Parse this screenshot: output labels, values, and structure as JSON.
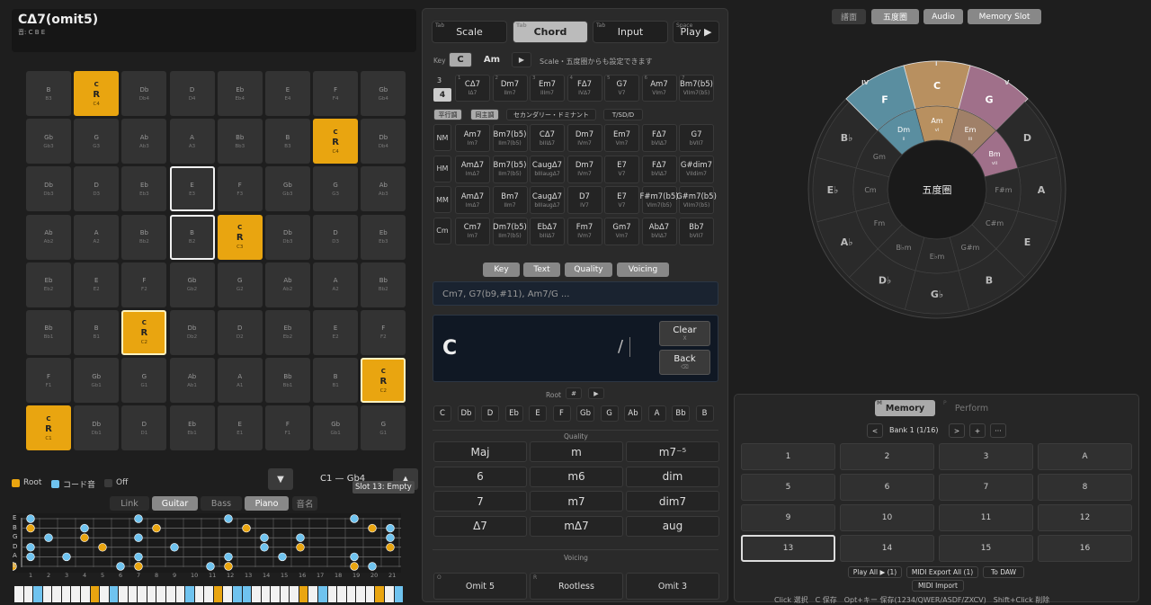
{
  "chord": {
    "name": "CΔ7(omit5)",
    "tones": "音: C B E"
  },
  "pads": [
    [
      [
        "B",
        "",
        "B3",
        ""
      ],
      [
        "C",
        "R",
        "C4",
        "root"
      ],
      [
        "Db",
        "",
        "Db4",
        ""
      ],
      [
        "D",
        "",
        "D4",
        ""
      ],
      [
        "Eb",
        "",
        "Eb4",
        ""
      ],
      [
        "E",
        "",
        "E4",
        ""
      ],
      [
        "F",
        "",
        "F4",
        ""
      ],
      [
        "Gb",
        "",
        "Gb4",
        ""
      ]
    ],
    [
      [
        "Gb",
        "",
        "Gb3",
        ""
      ],
      [
        "G",
        "",
        "G3",
        ""
      ],
      [
        "Ab",
        "",
        "Ab3",
        ""
      ],
      [
        "A",
        "",
        "A3",
        ""
      ],
      [
        "Bb",
        "",
        "Bb3",
        ""
      ],
      [
        "B",
        "",
        "B3",
        ""
      ],
      [
        "C",
        "R",
        "C4",
        "root"
      ],
      [
        "Db",
        "",
        "Db4",
        ""
      ]
    ],
    [
      [
        "Db",
        "",
        "Db3",
        ""
      ],
      [
        "D",
        "",
        "D3",
        ""
      ],
      [
        "Eb",
        "",
        "Eb3",
        ""
      ],
      [
        "E",
        "",
        "E3",
        "sel"
      ],
      [
        "F",
        "",
        "F3",
        ""
      ],
      [
        "Gb",
        "",
        "Gb3",
        ""
      ],
      [
        "G",
        "",
        "G3",
        ""
      ],
      [
        "Ab",
        "",
        "Ab3",
        ""
      ]
    ],
    [
      [
        "Ab",
        "",
        "Ab2",
        ""
      ],
      [
        "A",
        "",
        "A2",
        ""
      ],
      [
        "Bb",
        "",
        "Bb2",
        ""
      ],
      [
        "B",
        "",
        "B2",
        "sel"
      ],
      [
        "C",
        "R",
        "C3",
        "root"
      ],
      [
        "Db",
        "",
        "Db3",
        ""
      ],
      [
        "D",
        "",
        "D3",
        ""
      ],
      [
        "Eb",
        "",
        "Eb3",
        ""
      ]
    ],
    [
      [
        "Eb",
        "",
        "Eb2",
        ""
      ],
      [
        "E",
        "",
        "E2",
        ""
      ],
      [
        "F",
        "",
        "F2",
        ""
      ],
      [
        "Gb",
        "",
        "Gb2",
        ""
      ],
      [
        "G",
        "",
        "G2",
        ""
      ],
      [
        "Ab",
        "",
        "Ab2",
        ""
      ],
      [
        "A",
        "",
        "A2",
        ""
      ],
      [
        "Bb",
        "",
        "Bb2",
        ""
      ]
    ],
    [
      [
        "Bb",
        "",
        "Bb1",
        ""
      ],
      [
        "B",
        "",
        "B1",
        ""
      ],
      [
        "C",
        "R",
        "C2",
        "roothl"
      ],
      [
        "Db",
        "",
        "Db2",
        ""
      ],
      [
        "D",
        "",
        "D2",
        ""
      ],
      [
        "Eb",
        "",
        "Eb2",
        ""
      ],
      [
        "E",
        "",
        "E2",
        ""
      ],
      [
        "F",
        "",
        "F2",
        ""
      ]
    ],
    [
      [
        "F",
        "",
        "F1",
        ""
      ],
      [
        "Gb",
        "",
        "Gb1",
        ""
      ],
      [
        "G",
        "",
        "G1",
        ""
      ],
      [
        "Ab",
        "",
        "Ab1",
        ""
      ],
      [
        "A",
        "",
        "A1",
        ""
      ],
      [
        "Bb",
        "",
        "Bb1",
        ""
      ],
      [
        "B",
        "",
        "B1",
        ""
      ],
      [
        "C",
        "R",
        "C2",
        "roothl"
      ]
    ],
    [
      [
        "C",
        "R",
        "C1",
        "root"
      ],
      [
        "Db",
        "",
        "Db1",
        ""
      ],
      [
        "D",
        "",
        "D1",
        ""
      ],
      [
        "Eb",
        "",
        "Eb1",
        ""
      ],
      [
        "E",
        "",
        "E1",
        ""
      ],
      [
        "F",
        "",
        "F1",
        ""
      ],
      [
        "Gb",
        "",
        "Gb1",
        ""
      ],
      [
        "G",
        "",
        "G1",
        ""
      ]
    ]
  ],
  "legend": {
    "root": "Root",
    "chord": "コード音",
    "off": "Off"
  },
  "range": "C1 — Gb4",
  "tooltip": "Slot 13: Empty",
  "instr": [
    "Link",
    "Guitar",
    "Bass",
    "Piano",
    "音名"
  ],
  "strings": [
    "E",
    "B",
    "G",
    "D",
    "A",
    "E"
  ],
  "frets": [
    "1",
    "2",
    "3",
    "4",
    "5",
    "6",
    "7",
    "8",
    "9",
    "10",
    "11",
    "12",
    "13",
    "14",
    "15",
    "16",
    "17",
    "18",
    "19",
    "20",
    "21"
  ],
  "mid": {
    "tabs": [
      {
        "k": "Tab",
        "l": "Scale"
      },
      {
        "k": "Tab",
        "l": "Chord"
      },
      {
        "k": "Tab",
        "l": "Input"
      },
      {
        "k": "Space",
        "l": "Play ▶"
      }
    ],
    "keyLabel": "Key",
    "keyC": "C",
    "keyAm": "Am",
    "play": "▶",
    "keyNote": "Scale・五度圏からも設定できます",
    "n3": "3",
    "n4": "4",
    "diatonic": [
      [
        "1",
        "CΔ7",
        "IΔ7"
      ],
      [
        "2",
        "Dm7",
        "IIm7"
      ],
      [
        "3",
        "Em7",
        "IIIm7"
      ],
      [
        "4",
        "FΔ7",
        "IVΔ7"
      ],
      [
        "5",
        "G7",
        "V7"
      ],
      [
        "6",
        "Am7",
        "VIm7"
      ],
      [
        "7",
        "Bm7(b5)",
        "VIIm7(b5)"
      ]
    ],
    "pills": [
      "平行調",
      "同主調",
      "セカンダリー・ドミナント",
      "T/SD/D"
    ],
    "rows": [
      {
        "h": "NM",
        "c": [
          [
            "Am7",
            "Im7"
          ],
          [
            "Bm7(b5)",
            "IIm7(b5)"
          ],
          [
            "CΔ7",
            "bIIIΔ7"
          ],
          [
            "Dm7",
            "IVm7"
          ],
          [
            "Em7",
            "Vm7"
          ],
          [
            "FΔ7",
            "bVIΔ7"
          ],
          [
            "G7",
            "bVII7"
          ]
        ]
      },
      {
        "h": "HM",
        "c": [
          [
            "AmΔ7",
            "ImΔ7"
          ],
          [
            "Bm7(b5)",
            "IIm7(b5)"
          ],
          [
            "CaugΔ7",
            "bIIIaugΔ7"
          ],
          [
            "Dm7",
            "IVm7"
          ],
          [
            "E7",
            "V7"
          ],
          [
            "FΔ7",
            "bVIΔ7"
          ],
          [
            "G#dim7",
            "VIIdim7"
          ]
        ]
      },
      {
        "h": "MM",
        "c": [
          [
            "AmΔ7",
            "ImΔ7"
          ],
          [
            "Bm7",
            "IIm7"
          ],
          [
            "CaugΔ7",
            "bIIIaugΔ7"
          ],
          [
            "D7",
            "IV7"
          ],
          [
            "E7",
            "V7"
          ],
          [
            "F#m7(b5)",
            "VIm7(b5)"
          ],
          [
            "G#m7(b5)",
            "VIIm7(b5)"
          ]
        ]
      },
      {
        "h": "Cm",
        "c": [
          [
            "Cm7",
            "Im7"
          ],
          [
            "Dm7(b5)",
            "IIm7(b5)"
          ],
          [
            "EbΔ7",
            "bIIIΔ7"
          ],
          [
            "Fm7",
            "IVm7"
          ],
          [
            "Gm7",
            "Vm7"
          ],
          [
            "AbΔ7",
            "bVIΔ7"
          ],
          [
            "Bb7",
            "bVII7"
          ]
        ]
      }
    ],
    "subtabs": [
      "Key",
      "Text",
      "Quality",
      "Voicing"
    ],
    "placeholder": "Cm7, G7(b9,#11), Am7/G ...",
    "display": "C",
    "slash": "/",
    "clear": "Clear",
    "clearK": "X",
    "back": "Back",
    "backK": "⌫",
    "rootLabel": "Root",
    "sharp": "#",
    "rootPlay": "▶",
    "roots": [
      "C",
      "Db",
      "D",
      "Eb",
      "E",
      "F",
      "Gb",
      "G",
      "Ab",
      "A",
      "Bb",
      "B"
    ],
    "qualityLabel": "Quality",
    "qualities": [
      "Maj",
      "m",
      "m7⁻⁵",
      "6",
      "m6",
      "dim",
      "7",
      "m7",
      "dim7",
      "Δ7",
      "mΔ7",
      "aug"
    ],
    "voicingLabel": "Voicing",
    "voicings": [
      {
        "k": "O",
        "l": "Omit 5"
      },
      {
        "k": "R",
        "l": "Rootless"
      },
      {
        "k": "",
        "l": "Omit 3"
      }
    ]
  },
  "right": {
    "tabs": [
      "譜面",
      "五度圏",
      "Audio",
      "Memory Slot"
    ],
    "center": "五度圏",
    "roman": [
      "IV",
      "I",
      "V"
    ],
    "outer": [
      "C",
      "G",
      "D",
      "A",
      "E",
      "B",
      "G♭",
      "D♭",
      "A♭",
      "E♭",
      "B♭",
      "F"
    ],
    "inner": [
      "Am",
      "Em",
      "Bm",
      "F#m",
      "C#m",
      "G#m",
      "E♭m",
      "B♭m",
      "Fm",
      "Cm",
      "Gm",
      "Dm"
    ],
    "degree": [
      "vi",
      "iii",
      "vii",
      "",
      "",
      "",
      "",
      "",
      "",
      "",
      "",
      "ii"
    ],
    "colors": {
      "C": "#b89060",
      "G": "#a0708a",
      "F": "#5a8ea0",
      "Am": "#b89060",
      "Em": "#a08068",
      "Bm": "#a0708a",
      "Dm": "#5a8ea0"
    },
    "memTabs": [
      "Memory",
      "Perform"
    ],
    "memK": "M",
    "perfK": "P",
    "bank": "Bank 1 (1/16)",
    "prev": "<",
    "next": ">",
    "plus": "+",
    "more": "···",
    "slots": [
      "1",
      "2",
      "3",
      "A",
      "5",
      "6",
      "7",
      "8",
      "9",
      "10",
      "11",
      "12",
      "13",
      "14",
      "15",
      "16"
    ],
    "bottom": [
      "Play All ▶ (1)",
      "MIDI Export All (1)",
      "To DAW",
      "MIDI Import"
    ],
    "hint": "Click 選択　C 保存　Opt+キー 保存(1234/QWER/ASDF/ZXCV)　Shift+Click 削除"
  }
}
